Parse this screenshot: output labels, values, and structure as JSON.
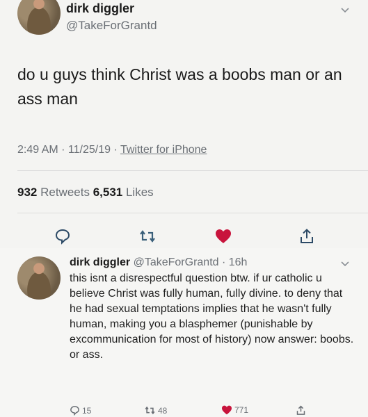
{
  "tweet": {
    "author_name": "dirk diggler",
    "author_handle": "@TakeForGrantd",
    "text": "do u guys think Christ was a boobs man or an ass man",
    "time": "2:49 AM · 11/25/19 · ",
    "source": "Twitter for iPhone",
    "retweets": "932",
    "retweets_label": " Retweets ",
    "likes": "6,531",
    "likes_label": " Likes"
  },
  "reply": {
    "author_name": "dirk diggler",
    "author_handle": "@TakeForGrantd · 16h",
    "text": "this isnt a disrespectful question btw. if ur catholic u believe Christ was fully human, fully divine. to deny that he had sexual temptations implies that he wasn't fully human, making you a blasphemer (punishable by excommunication for most of history) now answer: boobs. or ass.",
    "reply_count": "15",
    "retweet_count": "48",
    "like_count": "771"
  },
  "colors": {
    "like": "#c8143c",
    "muted": "#6a6f75",
    "retweet": "#3a5f7a"
  },
  "icons": [
    "chevron-down-icon",
    "reply-icon",
    "retweet-icon",
    "heart-icon",
    "share-icon"
  ]
}
